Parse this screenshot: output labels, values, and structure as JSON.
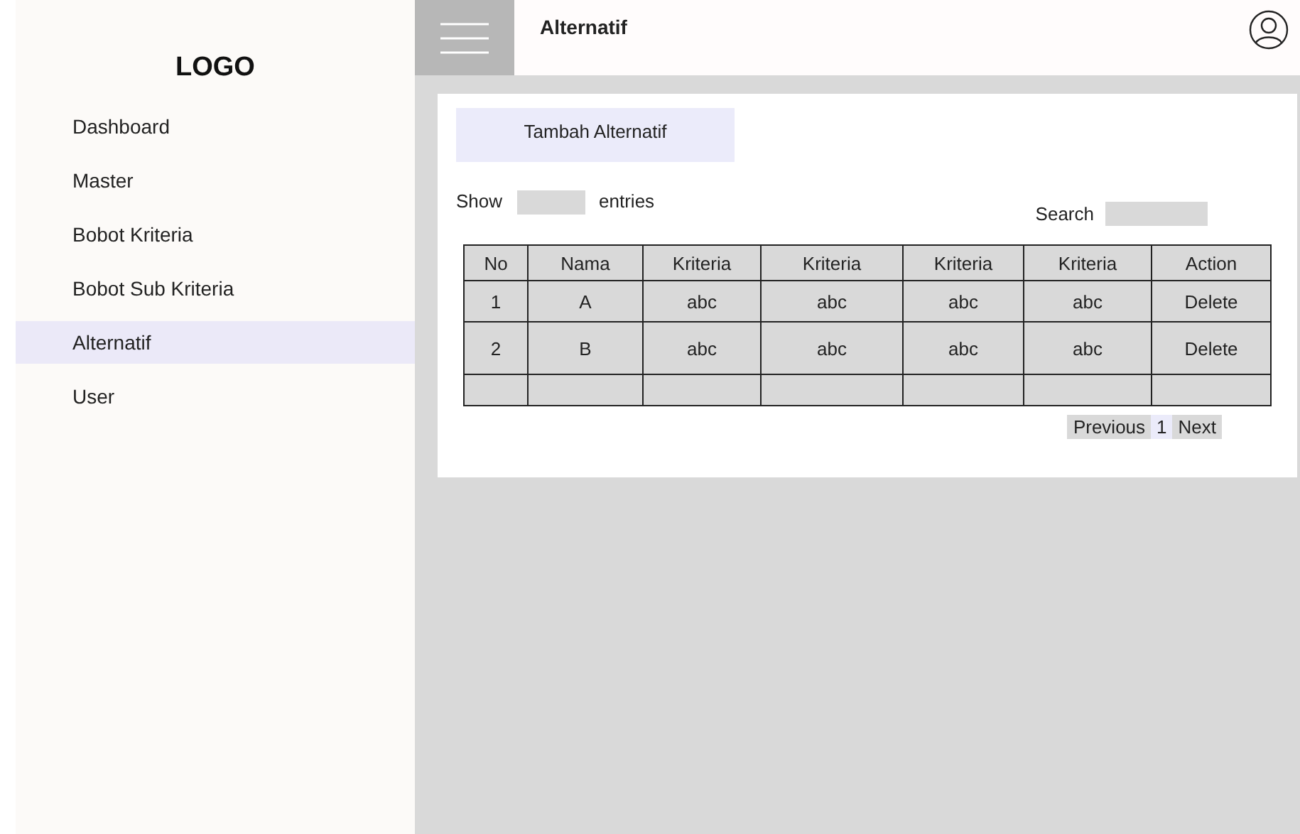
{
  "sidebar": {
    "logo": "LOGO",
    "items": [
      {
        "label": "Dashboard",
        "selected": false
      },
      {
        "label": "Master",
        "selected": false
      },
      {
        "label": "Bobot Kriteria",
        "selected": false
      },
      {
        "label": "Bobot Sub Kriteria",
        "selected": false
      },
      {
        "label": "Alternatif",
        "selected": true
      },
      {
        "label": "User",
        "selected": false
      }
    ]
  },
  "header": {
    "title": "Alternatif"
  },
  "add_button": "Tambah Alternatif",
  "show": {
    "before": "Show",
    "after": "entries"
  },
  "search": {
    "label": "Search"
  },
  "table": {
    "columns": [
      "No",
      "Nama",
      "Kriteria",
      "Kriteria",
      "Kriteria",
      "Kriteria",
      "Action"
    ],
    "rows": [
      [
        "1",
        "A",
        "abc",
        "abc",
        "abc",
        "abc",
        "Delete"
      ],
      [
        "2",
        "B",
        "abc",
        "abc",
        "abc",
        "abc",
        "Delete"
      ],
      [
        "",
        "",
        "",
        "",
        "",
        "",
        ""
      ]
    ]
  },
  "pagination": [
    {
      "label": "Previous",
      "selected": false
    },
    {
      "label": "1",
      "selected": true
    },
    {
      "label": "Next",
      "selected": false
    }
  ]
}
